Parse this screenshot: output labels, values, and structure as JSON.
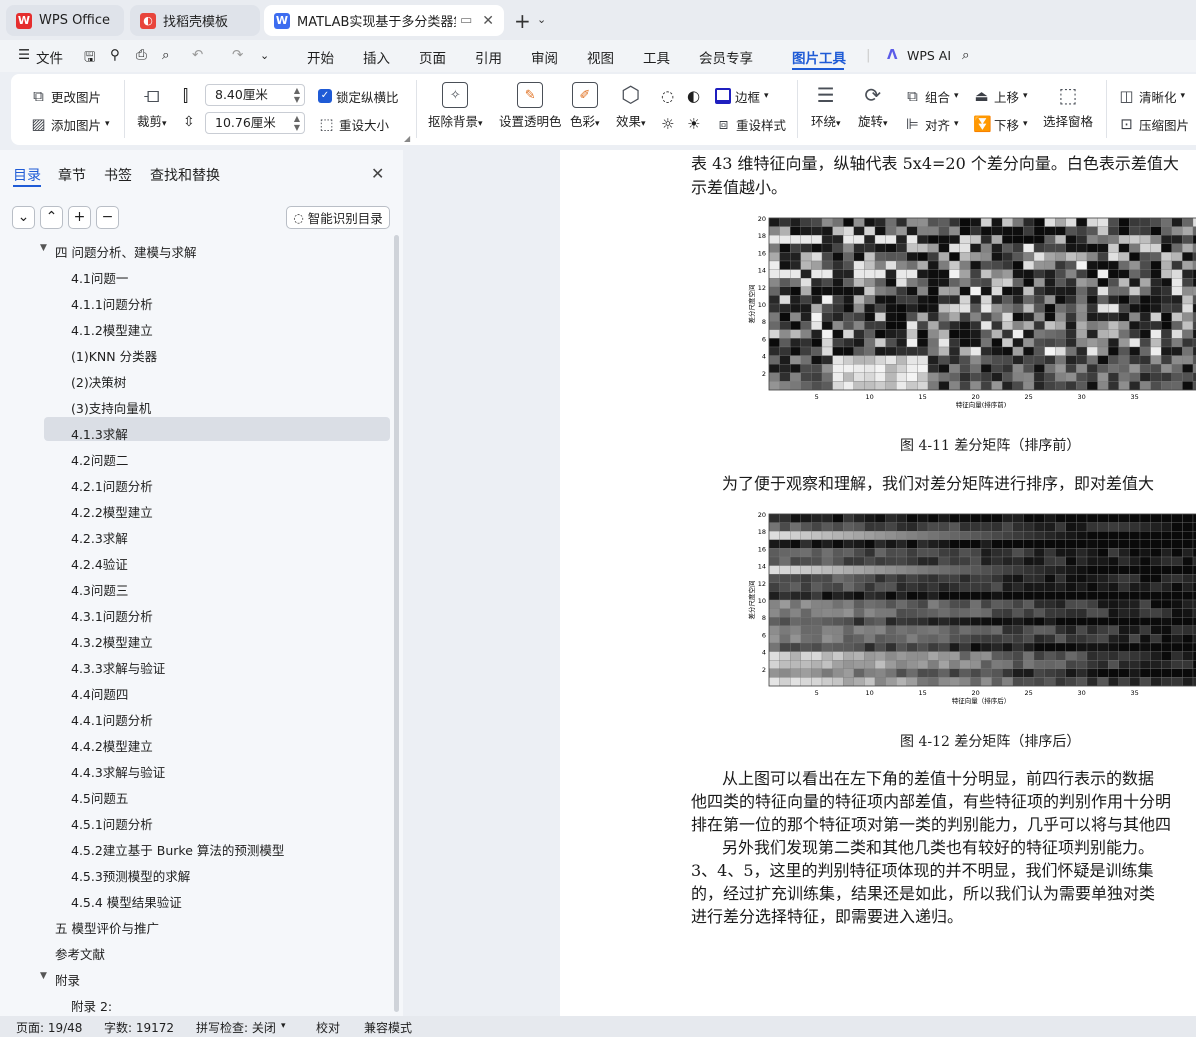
{
  "tabs": [
    {
      "label": "WPS Office",
      "logo": "W",
      "color": "#e52e2e"
    },
    {
      "label": "找稻壳模板",
      "logo": "◐",
      "color": "#e8453c"
    },
    {
      "label": "MATLAB实现基于多分类器集",
      "logo": "W",
      "color": "#3d6df0"
    }
  ],
  "menu": {
    "file": "文件",
    "items": [
      "开始",
      "插入",
      "页面",
      "引用",
      "审阅",
      "视图",
      "工具",
      "会员专享",
      "图片工具"
    ],
    "active": "图片工具",
    "wps_ai": "WPS AI"
  },
  "ribbon": {
    "change_picture": "更改图片",
    "add_picture": "添加图片",
    "crop": "裁剪",
    "width": "8.40厘米",
    "height": "10.76厘米",
    "lock_ratio": "锁定纵横比",
    "reset_size": "重设大小",
    "remove_bg": "抠除背景",
    "set_transparent": "设置透明色",
    "color": "色彩",
    "effects": "效果",
    "border": "边框",
    "reset_style": "重设样式",
    "wrap": "环绕",
    "rotate": "旋转",
    "group": "组合",
    "align": "对齐",
    "bring_forward": "上移",
    "send_backward": "下移",
    "selection_pane": "选择窗格",
    "sharpen": "清晰化",
    "compress": "压缩图片"
  },
  "nav": {
    "tabs": [
      "目录",
      "章节",
      "书签",
      "查找和替换"
    ],
    "smart_toc": "智能识别目录",
    "items": [
      {
        "label": "四 问题分析、建模与求解",
        "level": 0,
        "expand": true
      },
      {
        "label": "4.1问题一",
        "level": 1
      },
      {
        "label": "4.1.1问题分析",
        "level": 1
      },
      {
        "label": "4.1.2模型建立",
        "level": 1
      },
      {
        "label": "(1)KNN 分类器",
        "level": 1
      },
      {
        "label": "(2)决策树",
        "level": 1
      },
      {
        "label": "(3)支持向量机",
        "level": 1
      },
      {
        "label": "4.1.3求解",
        "level": 1,
        "selected": true
      },
      {
        "label": "4.2问题二",
        "level": 1
      },
      {
        "label": "4.2.1问题分析",
        "level": 1
      },
      {
        "label": "4.2.2模型建立",
        "level": 1
      },
      {
        "label": "4.2.3求解",
        "level": 1
      },
      {
        "label": "4.2.4验证",
        "level": 1
      },
      {
        "label": "4.3问题三",
        "level": 1
      },
      {
        "label": "4.3.1问题分析",
        "level": 1
      },
      {
        "label": "4.3.2模型建立",
        "level": 1
      },
      {
        "label": "4.3.3求解与验证",
        "level": 1
      },
      {
        "label": "4.4问题四",
        "level": 1
      },
      {
        "label": "4.4.1问题分析",
        "level": 1
      },
      {
        "label": "4.4.2模型建立",
        "level": 1
      },
      {
        "label": "4.4.3求解与验证",
        "level": 1
      },
      {
        "label": "4.5问题五",
        "level": 1
      },
      {
        "label": "4.5.1问题分析",
        "level": 1
      },
      {
        "label": "4.5.2建立基于 Burke 算法的预测模型",
        "level": 1
      },
      {
        "label": "4.5.3预测模型的求解",
        "level": 1
      },
      {
        "label": "4.5.4 模型结果验证",
        "level": 1
      },
      {
        "label": "五 模型评价与推广",
        "level": 0
      },
      {
        "label": "参考文献",
        "level": 0
      },
      {
        "label": "附录",
        "level": 0,
        "expand": true
      },
      {
        "label": "附录 2:",
        "level": 1
      }
    ]
  },
  "doc": {
    "line1": "表 43 维特征向量，纵轴代表 5x4=20 个差分向量。白色表示差值大",
    "line2": "示差值越小。",
    "fig1": {
      "ylabel": "差分尺度空间",
      "xlabel": "特征向量(排序前)",
      "yticks": [
        "20",
        "18",
        "16",
        "14",
        "12",
        "10",
        "8",
        "6",
        "4",
        "2"
      ],
      "xticks": [
        "5",
        "10",
        "15",
        "20",
        "25",
        "30",
        "35"
      ]
    },
    "caption1": "图 4-11  差分矩阵（排序前）",
    "para1": "为了便于观察和理解，我们对差分矩阵进行排序，即对差值大",
    "fig2": {
      "ylabel": "差分尺度空间",
      "xlabel": "特征向量（排序后）",
      "yticks": [
        "20",
        "18",
        "16",
        "14",
        "12",
        "10",
        "8",
        "6",
        "4",
        "2"
      ],
      "xticks": [
        "5",
        "10",
        "15",
        "20",
        "25",
        "30",
        "35"
      ]
    },
    "caption2": "图 4-12  差分矩阵（排序后）",
    "para2": [
      "从上图可以看出在左下角的差值十分明显，前四行表示的数据",
      "他四类的特征向量的特征项内部差值，有些特征项的判别作用十分明",
      "排在第一位的那个特征项对第一类的判别能力，几乎可以将与其他四",
      "另外我们发现第二类和其他几类也有较好的特征项判别能力。",
      "3、4、5，这里的判别特征项体现的并不明显，我们怀疑是训练集",
      "的，经过扩充训练集，结果还是如此，所以我们认为需要单独对类",
      "进行差分选择特征，即需要进入递归。"
    ]
  },
  "status": {
    "page": "页面: 19/48",
    "words": "字数: 19172",
    "spell": "拼写检查: 关闭",
    "proof": "校对",
    "compat": "兼容模式"
  }
}
